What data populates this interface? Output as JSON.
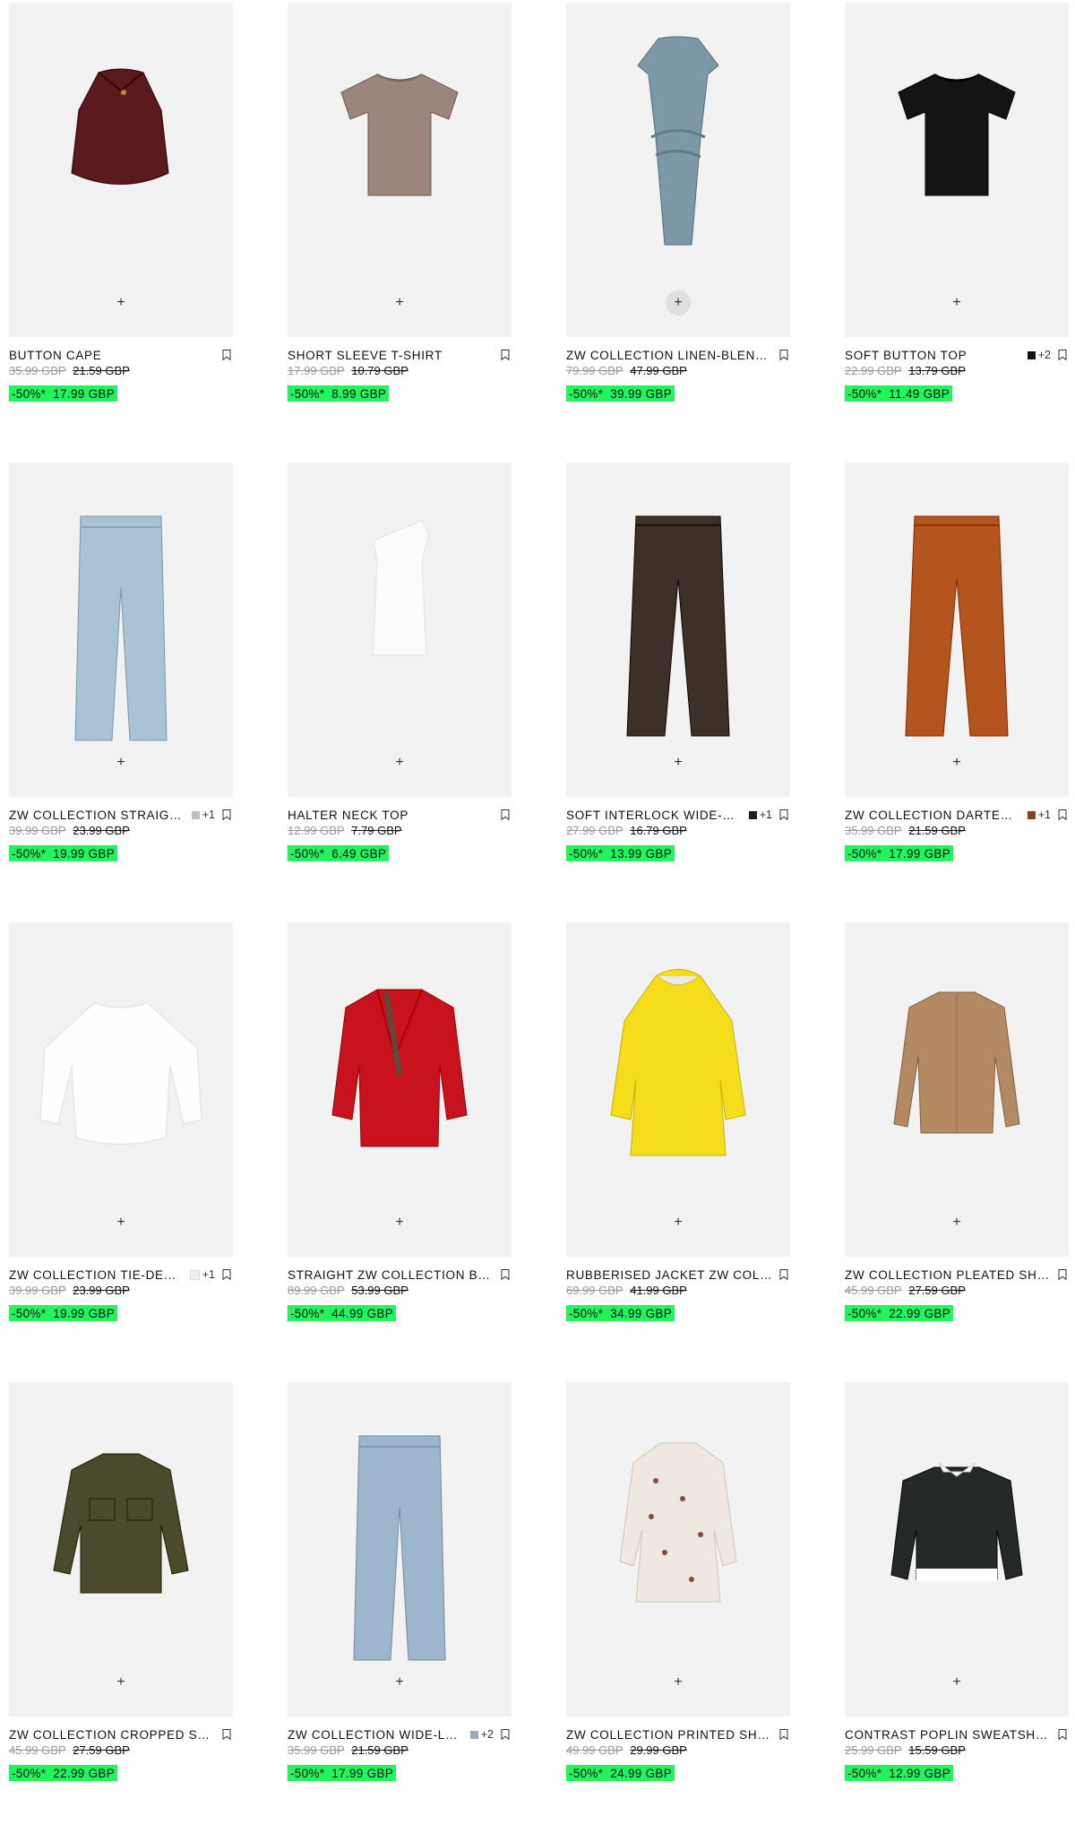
{
  "products": [
    {
      "name": "BUTTON CAPE",
      "original": "35.99 GBP",
      "reduced": "21.59 GBP",
      "discount": "-50%*",
      "sale": "17.99 GBP",
      "swatch": "",
      "more": "",
      "garment": "cape",
      "color": "#5a1a1e",
      "highlight": false
    },
    {
      "name": "SHORT SLEEVE T-SHIRT",
      "original": "17.99 GBP",
      "reduced": "10.79 GBP",
      "discount": "-50%*",
      "sale": "8.99 GBP",
      "swatch": "",
      "more": "",
      "garment": "tee",
      "color": "#9a867c",
      "highlight": false
    },
    {
      "name": "ZW COLLECTION LINEN-BLEND DRAPED DRESS",
      "original": "79.99 GBP",
      "reduced": "47.99 GBP",
      "discount": "-50%*",
      "sale": "39.99 GBP",
      "swatch": "",
      "more": "",
      "garment": "dress",
      "color": "#7d98a6",
      "highlight": true
    },
    {
      "name": "SOFT BUTTON TOP",
      "original": "22.99 GBP",
      "reduced": "13.79 GBP",
      "discount": "-50%*",
      "sale": "11.49 GBP",
      "swatch": "#111111",
      "more": "+2",
      "garment": "tee",
      "color": "#141414",
      "highlight": false
    },
    {
      "name": "ZW COLLECTION STRAIGHT JEANS",
      "original": "39.99 GBP",
      "reduced": "23.99 GBP",
      "discount": "-50%*",
      "sale": "19.99 GBP",
      "swatch": "#b7c3cc",
      "more": "+1",
      "garment": "jeans",
      "color": "#a9c2d4",
      "highlight": false
    },
    {
      "name": "HALTER NECK TOP",
      "original": "12.99 GBP",
      "reduced": "7.79 GBP",
      "discount": "-50%*",
      "sale": "6.49 GBP",
      "swatch": "",
      "more": "",
      "garment": "tank",
      "color": "#fbfbfb",
      "highlight": false
    },
    {
      "name": "SOFT INTERLOCK WIDE-LEG TROUSERS",
      "original": "27.99 GBP",
      "reduced": "16.79 GBP",
      "discount": "-50%*",
      "sale": "13.99 GBP",
      "swatch": "#1e1e1e",
      "more": "+1",
      "garment": "trousers",
      "color": "#3b3128",
      "highlight": false
    },
    {
      "name": "ZW COLLECTION DARTED TROUSERS",
      "original": "35.99 GBP",
      "reduced": "21.59 GBP",
      "discount": "-50%*",
      "sale": "17.99 GBP",
      "swatch": "#8b3f1a",
      "more": "+1",
      "garment": "trousers",
      "color": "#b4541e",
      "highlight": false
    },
    {
      "name": "ZW COLLECTION TIE-DETAIL BLOUSE",
      "original": "39.99 GBP",
      "reduced": "23.99 GBP",
      "discount": "-50%*",
      "sale": "19.99 GBP",
      "swatch": "#f0f0f0",
      "more": "+1",
      "garment": "blouse",
      "color": "#fdfdfd",
      "highlight": false
    },
    {
      "name": "STRAIGHT ZW COLLECTION BLAZER",
      "original": "89.99 GBP",
      "reduced": "53.99 GBP",
      "discount": "-50%*",
      "sale": "44.99 GBP",
      "swatch": "",
      "more": "",
      "garment": "blazer",
      "color": "#c8121e",
      "highlight": false
    },
    {
      "name": "RUBBERISED JACKET ZW COLLECTION",
      "original": "69.99 GBP",
      "reduced": "41.99 GBP",
      "discount": "-50%*",
      "sale": "34.99 GBP",
      "swatch": "",
      "more": "",
      "garment": "raincoat",
      "color": "#f6dd1c",
      "highlight": false
    },
    {
      "name": "ZW COLLECTION PLEATED SHIRT",
      "original": "45.99 GBP",
      "reduced": "27.59 GBP",
      "discount": "-50%*",
      "sale": "22.99 GBP",
      "swatch": "",
      "more": "",
      "garment": "shirt",
      "color": "#b48a64",
      "highlight": false
    },
    {
      "name": "ZW COLLECTION CROPPED SHIRT",
      "original": "45.99 GBP",
      "reduced": "27.59 GBP",
      "discount": "-50%*",
      "sale": "22.99 GBP",
      "swatch": "",
      "more": "",
      "garment": "jacket",
      "color": "#4b4a2c",
      "highlight": false
    },
    {
      "name": "ZW COLLECTION WIDE-LEG JEANS",
      "original": "35.99 GBP",
      "reduced": "21.59 GBP",
      "discount": "-50%*",
      "sale": "17.99 GBP",
      "swatch": "#9aaab6",
      "more": "+2",
      "garment": "jeans",
      "color": "#9db6cb",
      "highlight": false
    },
    {
      "name": "ZW COLLECTION PRINTED SHIRT DRESS",
      "original": "49.99 GBP",
      "reduced": "29.99 GBP",
      "discount": "-50%*",
      "sale": "24.99 GBP",
      "swatch": "",
      "more": "",
      "garment": "minidress",
      "color": "#efe8e0",
      "highlight": false
    },
    {
      "name": "CONTRAST POPLIN SWEATSHIRT",
      "original": "25.99 GBP",
      "reduced": "15.59 GBP",
      "discount": "-50%*",
      "sale": "12.99 GBP",
      "swatch": "",
      "more": "",
      "garment": "sweatshirt",
      "color": "#252a27",
      "highlight": false
    }
  ],
  "icons": {
    "add": "plus-icon",
    "save": "bookmark-icon"
  },
  "add_glyph": "+"
}
